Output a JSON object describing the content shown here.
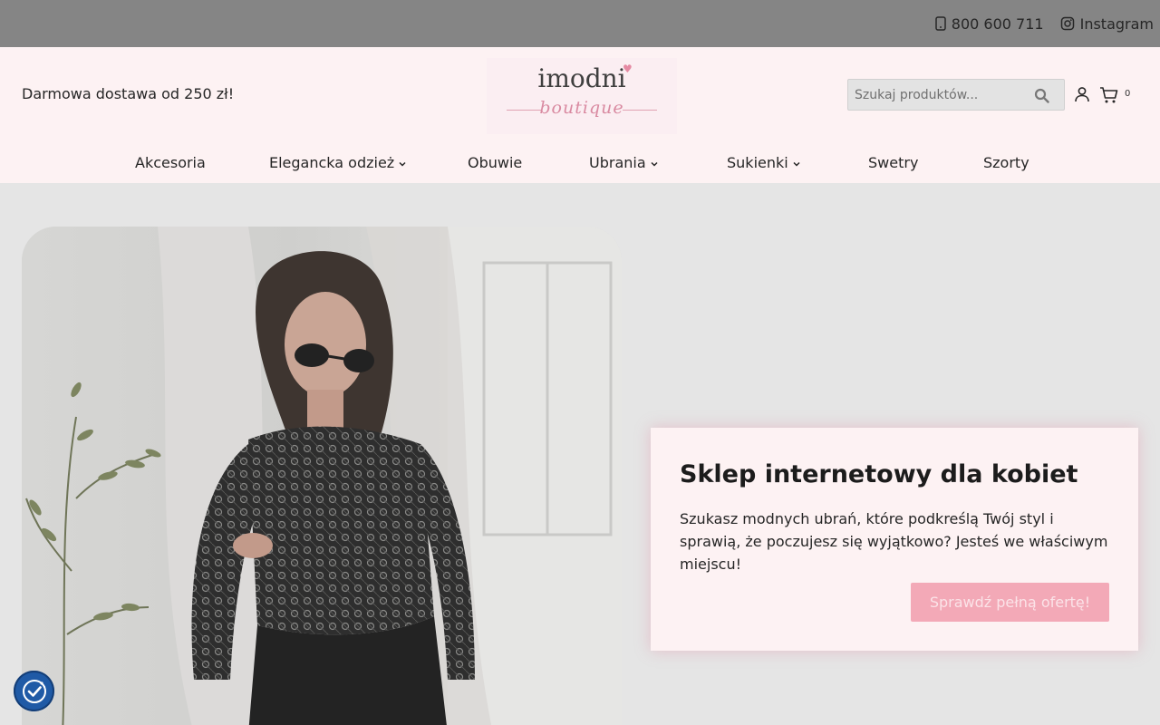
{
  "topbar": {
    "phone": "800 600 711",
    "instagram": "Instagram",
    "phone_icon": "phone-icon",
    "instagram_icon": "instagram-icon"
  },
  "header": {
    "promo": "Darmowa dostawa od 250 zł!",
    "logo": {
      "word": "imodni",
      "script": "boutique"
    },
    "search": {
      "placeholder": "Szukaj produktów..."
    },
    "cart_count": "0",
    "icons": [
      "search-icon",
      "user-icon",
      "cart-icon"
    ]
  },
  "nav": {
    "items": [
      {
        "label": "Akcesoria",
        "has_dropdown": false
      },
      {
        "label": "Elegancka odzież",
        "has_dropdown": true
      },
      {
        "label": "Obuwie",
        "has_dropdown": false
      },
      {
        "label": "Ubrania",
        "has_dropdown": true
      },
      {
        "label": "Sukienki",
        "has_dropdown": true
      },
      {
        "label": "Swetry",
        "has_dropdown": false
      },
      {
        "label": "Szorty",
        "has_dropdown": false
      }
    ]
  },
  "hero": {
    "title": "Sklep internetowy dla kobiet",
    "description": "Szukasz modnych ubrań, które podkreślą Twój styl i sprawią, że poczujesz się wyjątkowo? Jesteś we właściwym miejscu!",
    "cta": "Sprawdź pełną ofertę!"
  },
  "colors": {
    "topbar": "#858585",
    "header_bg": "#fdf2f3",
    "accent_pink": "#f3a9b7",
    "consent_blue": "#1f5aa6"
  },
  "consent": {
    "icon": "cookie-consent-icon"
  }
}
